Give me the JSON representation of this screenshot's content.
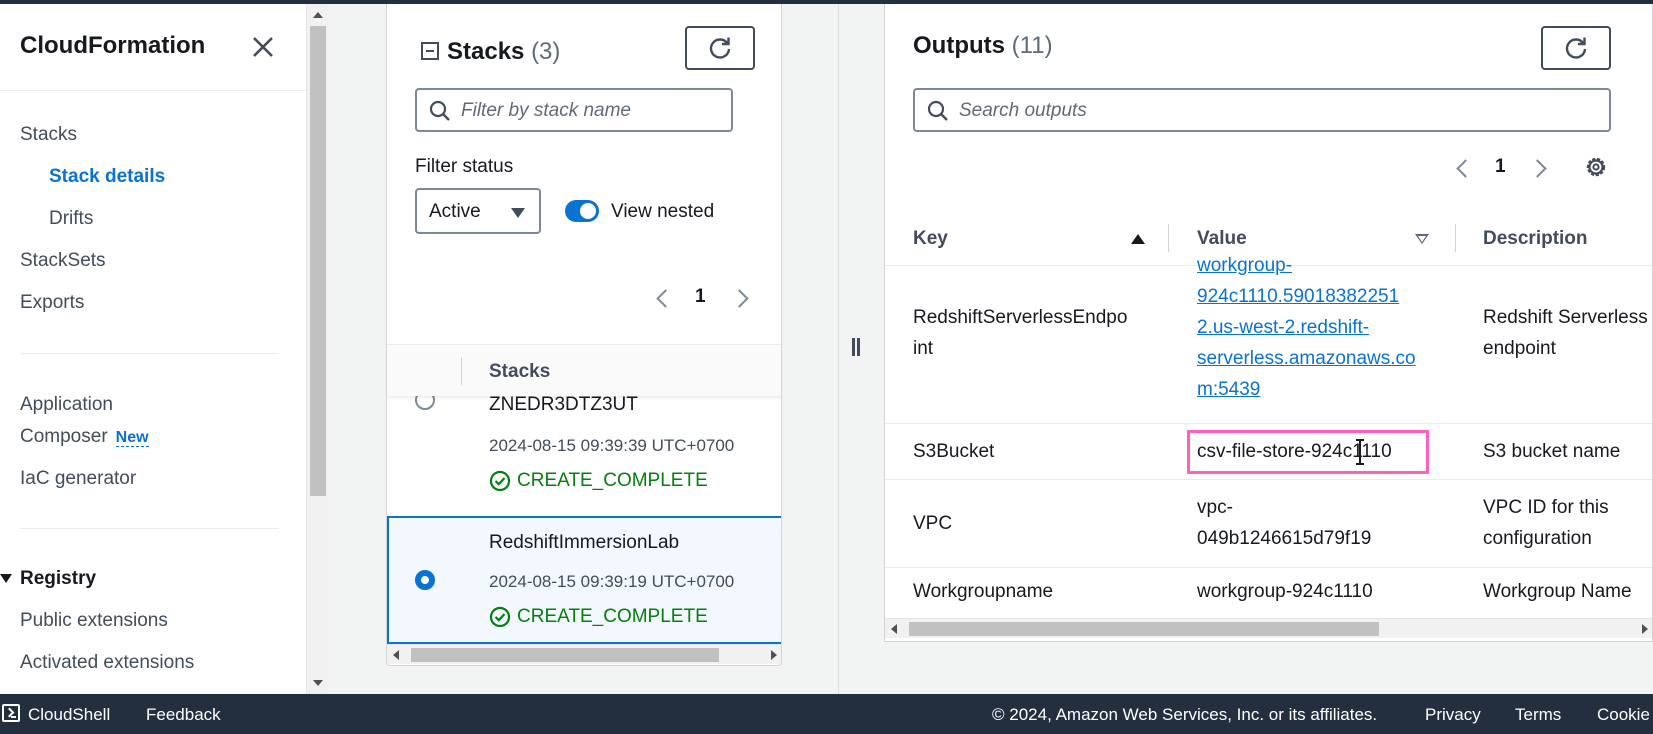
{
  "sidebar": {
    "title": "CloudFormation",
    "nav": {
      "stacks": "Stacks",
      "stack_details": "Stack details",
      "drifts": "Drifts",
      "stacksets": "StackSets",
      "exports": "Exports",
      "application": "Application",
      "composer": "Composer",
      "new_badge": "New",
      "iac_generator": "IaC generator",
      "registry": "Registry",
      "public_extensions": "Public extensions",
      "activated_extensions": "Activated extensions"
    }
  },
  "stacks_panel": {
    "title": "Stacks",
    "count": "(3)",
    "search_placeholder": "Filter by stack name",
    "filter_label": "Filter status",
    "filter_value": "Active",
    "view_nested_label": "View nested",
    "view_nested_on": true,
    "page": "1",
    "column_header": "Stacks",
    "rows": [
      {
        "name": "ZNEDR3DTZ3UT",
        "date": "2024-08-15 09:39:39 UTC+0700",
        "status": "CREATE_COMPLETE",
        "selected": false
      },
      {
        "name": "RedshiftImmersionLab",
        "date": "2024-08-15 09:39:19 UTC+0700",
        "status": "CREATE_COMPLETE",
        "selected": true
      }
    ]
  },
  "outputs_panel": {
    "title": "Outputs",
    "count": "(11)",
    "search_placeholder": "Search outputs",
    "page": "1",
    "columns": {
      "key": "Key",
      "value": "Value",
      "description": "Description"
    },
    "rows": [
      {
        "key": "RedshiftServerlessEndpoint",
        "key_display": "RedshiftServerlessEndpo\nint",
        "value": "workgroup-924c1110.590183822512.us-west-2.redshift-serverless.amazonaws.com:5439",
        "value_lines": [
          "workgroup-",
          "924c1110.59018382251",
          "2.us-west-2.redshift-",
          "serverless.amazonaws.co",
          "m:5439"
        ],
        "description_lines": [
          "Redshift Serverless",
          "endpoint"
        ]
      },
      {
        "key": "S3Bucket",
        "value": "csv-file-store-924c1110",
        "description": "S3 bucket name"
      },
      {
        "key": "VPC",
        "value_lines": [
          "vpc-",
          "049b1246615d79f19"
        ],
        "description_lines": [
          "VPC ID for this",
          "configuration"
        ]
      },
      {
        "key": "Workgroupname",
        "value": "workgroup-924c1110",
        "description": "Workgroup Name"
      }
    ]
  },
  "footer": {
    "cloudshell": "CloudShell",
    "feedback": "Feedback",
    "copyright": "© 2024, Amazon Web Services, Inc. or its affiliates.",
    "privacy": "Privacy",
    "terms": "Terms",
    "cookie": "Cookie"
  },
  "colors": {
    "accent": "#0972d3",
    "success": "#037f0c",
    "highlight": "#ff5fbd",
    "footer_bg": "#232f3e"
  }
}
